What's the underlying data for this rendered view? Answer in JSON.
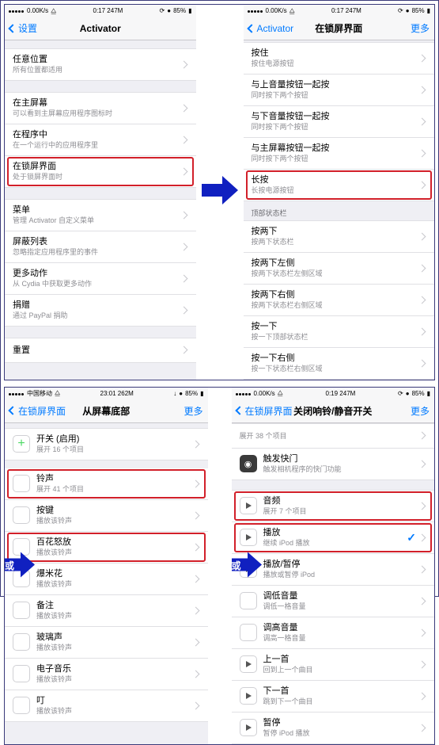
{
  "screens": {
    "s1": {
      "status": {
        "left": "0.00K/s",
        "time": "0:17 247M",
        "right": "85%"
      },
      "back": "设置",
      "title": "Activator",
      "groups": [
        {
          "rows": [
            {
              "t1": "任意位置",
              "t2": "所有位置都适用"
            }
          ]
        },
        {
          "rows": [
            {
              "t1": "在主屏幕",
              "t2": "可以看到主屏幕应用程序图标时"
            },
            {
              "t1": "在程序中",
              "t2": "在一个运行中的应用程序里"
            },
            {
              "t1": "在锁屏界面",
              "t2": "处于锁屏界面时",
              "hl": true
            }
          ]
        },
        {
          "rows": [
            {
              "t1": "菜单",
              "t2": "管理 Activator 自定义菜单"
            },
            {
              "t1": "屏蔽列表",
              "t2": "忽略指定应用程序里的事件"
            },
            {
              "t1": "更多动作",
              "t2": "从 Cydia 中获取更多动作"
            },
            {
              "t1": "捐赠",
              "t2": "通过 PayPal 捐助"
            }
          ]
        },
        {
          "rows": [
            {
              "t1": "重置"
            }
          ]
        }
      ]
    },
    "s2": {
      "status": {
        "left": "0.00K/s",
        "time": "0:17 247M",
        "right": "85%"
      },
      "back": "Activator",
      "title": "在锁屏界面",
      "more": "更多",
      "groups": [
        {
          "rows": [
            {
              "t1": "按住",
              "t2": "按住电源按钮"
            },
            {
              "t1": "与上音量按钮一起按",
              "t2": "同时按下两个按钮"
            },
            {
              "t1": "与下音量按钮一起按",
              "t2": "同时按下两个按钮"
            },
            {
              "t1": "与主屏幕按钮一起按",
              "t2": "同时按下两个按钮"
            },
            {
              "t1": "长按",
              "t2": "长按电源按钮",
              "hl": true
            }
          ]
        },
        {
          "header": "顶部状态栏",
          "rows": [
            {
              "t1": "按两下",
              "t2": "按两下状态栏"
            },
            {
              "t1": "按两下左侧",
              "t2": "按两下状态栏左侧区域"
            },
            {
              "t1": "按两下右侧",
              "t2": "按两下状态栏右侧区域"
            },
            {
              "t1": "按一下",
              "t2": "按一下顶部状态栏"
            },
            {
              "t1": "按一下右侧",
              "t2": "按一下状态栏右侧区域"
            }
          ]
        }
      ]
    },
    "s3": {
      "status": {
        "carrier": "中国移动",
        "time": "23:01 262M",
        "right": "85%"
      },
      "back": "在锁屏界面",
      "title": "从屏幕底部",
      "more": "更多",
      "or": "或",
      "rows": [
        {
          "icon": "plus",
          "t1": "开关 (启用)",
          "t2": "展开 16 个项目"
        },
        {
          "icon": "snd",
          "t1": "铃声",
          "t2": "展开 41 个项目",
          "hl": true
        },
        {
          "icon": "snd",
          "t1": "按键",
          "t2": "播放该铃声"
        },
        {
          "icon": "snd",
          "t1": "百花怒放",
          "t2": "播放该铃声",
          "hl": true
        },
        {
          "icon": "snd",
          "t1": "爆米花",
          "t2": "播放该铃声"
        },
        {
          "icon": "snd",
          "t1": "备注",
          "t2": "播放该铃声"
        },
        {
          "icon": "snd",
          "t1": "玻璃声",
          "t2": "播放该铃声"
        },
        {
          "icon": "snd",
          "t1": "电子音乐",
          "t2": "播放该铃声"
        },
        {
          "icon": "snd",
          "t1": "叮",
          "t2": "播放该铃声"
        }
      ]
    },
    "s4": {
      "status": {
        "left": "0.00K/s",
        "time": "0:19 247M",
        "right": "85%"
      },
      "back": "在锁屏界面",
      "title": "关闭响铃/静音开关",
      "more": "更多",
      "or": "或",
      "rows_top": [
        {
          "t2": "展开 38 个项目"
        },
        {
          "icon": "dark",
          "t1": "触发快门",
          "t2": "触发相机程序的快门功能"
        }
      ],
      "rows": [
        {
          "icon": "play",
          "t1": "音频",
          "t2": "展开 7 个项目",
          "hl": true
        },
        {
          "icon": "play",
          "t1": "播放",
          "t2": "继续 iPod 播放",
          "hl": true,
          "check": true
        },
        {
          "icon": "play",
          "t1": "播放/暂停",
          "t2": "播放或暂停 iPod"
        },
        {
          "icon": "bars",
          "t1": "调低音量",
          "t2": "调低一格音量"
        },
        {
          "icon": "bars",
          "t1": "调高音量",
          "t2": "调高一格音量"
        },
        {
          "icon": "play",
          "t1": "上一首",
          "t2": "回到上一个曲目"
        },
        {
          "icon": "play",
          "t1": "下一首",
          "t2": "跳到下一个曲目"
        },
        {
          "icon": "play",
          "t1": "暂停",
          "t2": "暂停 iPod 播放"
        }
      ]
    }
  }
}
